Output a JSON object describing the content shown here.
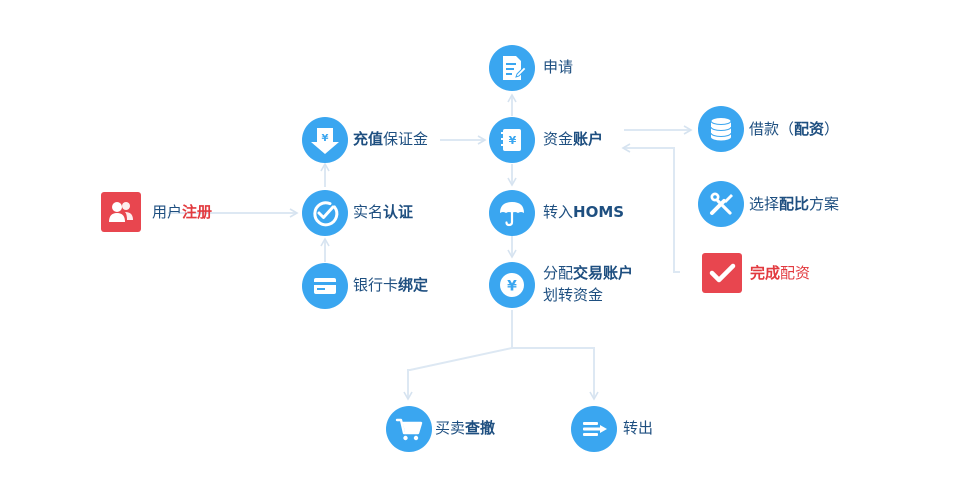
{
  "nodes": {
    "register": {
      "pre": "用户",
      "bold": "注册",
      "post": ""
    },
    "deposit": {
      "pre": "",
      "bold": "充值",
      "post": "保证金"
    },
    "realname": {
      "pre": "实名",
      "bold": "认证",
      "post": ""
    },
    "bindcard": {
      "pre": "银行卡",
      "bold": "绑定",
      "post": ""
    },
    "apply": {
      "pre": "申请",
      "bold": "",
      "post": ""
    },
    "fund": {
      "pre": "资金",
      "bold": "账户",
      "post": ""
    },
    "homs": {
      "pre": "转入",
      "bold": "HOMS",
      "post": ""
    },
    "allocate": {
      "pre": "分配",
      "bold": "交易账户",
      "post": "",
      "line2": "划转资金"
    },
    "borrow": {
      "pre": "借款（",
      "bold": "配资",
      "post": "）"
    },
    "ratio": {
      "pre": "选择",
      "bold": "配比",
      "post": "方案"
    },
    "complete": {
      "pre": "",
      "bold": "完成",
      "post": "配资"
    },
    "trade": {
      "pre": "买卖",
      "bold": "查撤",
      "post": ""
    },
    "transfer": {
      "pre": "转出",
      "bold": "",
      "post": ""
    }
  },
  "colors": {
    "circle": "#3aa6f0",
    "square": "#e8464f",
    "connector": "#dde8f3",
    "label": "#1e4f80",
    "label_red": "#e23a3f"
  },
  "icons": {
    "register": "users-icon",
    "deposit": "yen-down-icon",
    "realname": "check-circle-icon",
    "bindcard": "card-icon",
    "apply": "document-edit-icon",
    "fund": "yen-book-icon",
    "homs": "umbrella-icon",
    "allocate": "yen-circle-icon",
    "borrow": "coins-icon",
    "ratio": "tools-icon",
    "complete": "checkmark-icon",
    "trade": "cart-icon",
    "transfer": "transfer-icon"
  }
}
